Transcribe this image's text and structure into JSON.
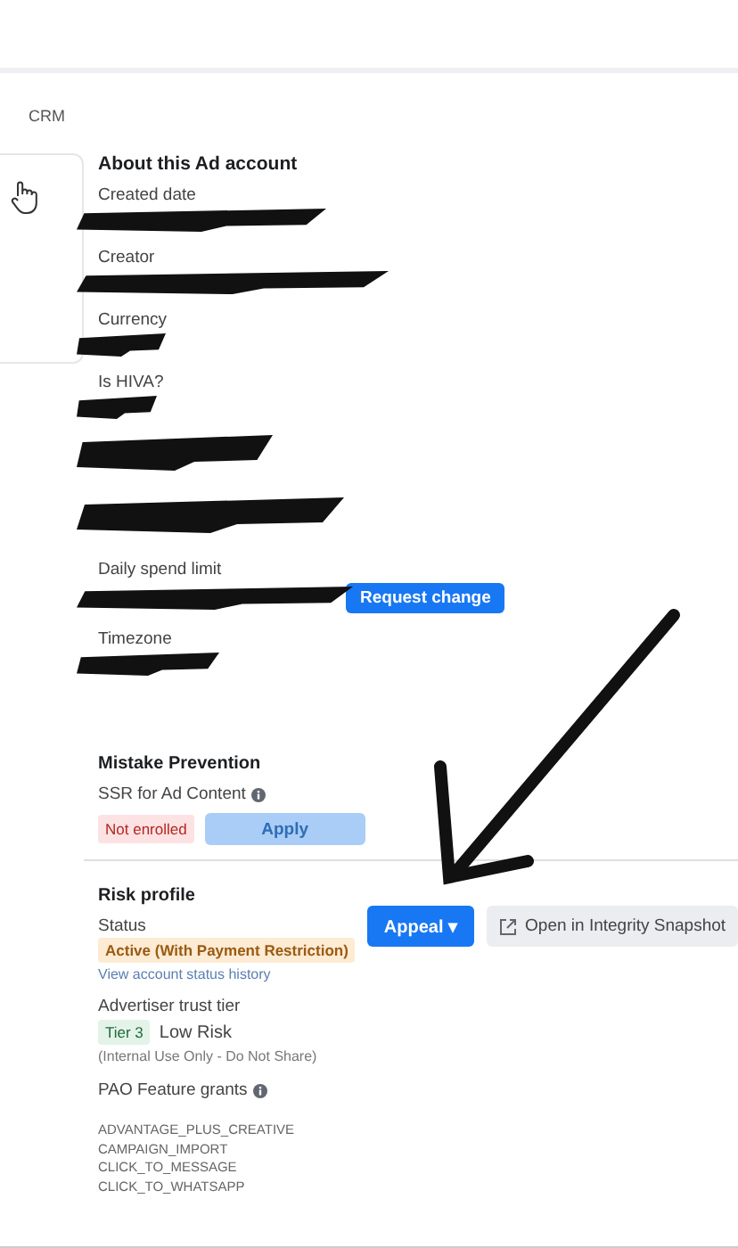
{
  "breadcrumb": "CRM",
  "about": {
    "title": "About this Ad account",
    "fields": [
      {
        "label": "Created date",
        "value_redacted": true
      },
      {
        "label": "Creator",
        "value_redacted": true
      },
      {
        "label": "Currency",
        "value_redacted": true
      },
      {
        "label": "Is HIVA?",
        "value_redacted": true
      },
      {
        "value_redacted": true
      },
      {
        "value_redacted": true
      },
      {
        "label": "Daily spend limit",
        "value_redacted": true,
        "action": "Request change"
      },
      {
        "label": "Timezone",
        "value_redacted": true
      }
    ]
  },
  "mistake_prevention": {
    "title": "Mistake Prevention",
    "setting": "SSR for Ad Content",
    "status": "Not enrolled",
    "button": {
      "label": "Apply",
      "disabled": true
    }
  },
  "risk_profile": {
    "title": "Risk profile",
    "status_label": "Status",
    "status": "Active (With Payment Restriction)",
    "history_link": "View account status history",
    "appeal_button": "Appeal ▾",
    "snapshot_button": "Open in Integrity Snapshot",
    "trust_label": "Advertiser trust tier",
    "tier": "Tier 3",
    "risk": "Low Risk",
    "note": "(Internal Use Only - Do Not Share)",
    "grants_label": "PAO Feature grants",
    "grants": [
      "ADVANTAGE_PLUS_CREATIVE",
      "CAMPAIGN_IMPORT",
      "CLICK_TO_MESSAGE",
      "CLICK_TO_WHATSAPP"
    ]
  }
}
